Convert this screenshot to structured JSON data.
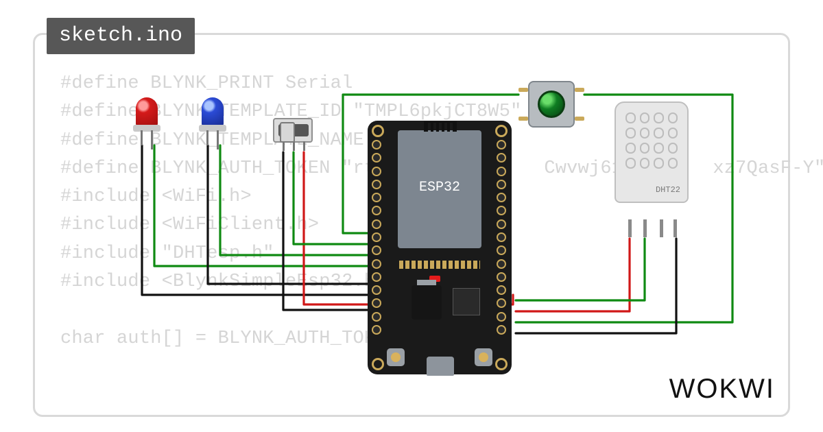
{
  "tab": {
    "filename": "sketch.ino"
  },
  "code": {
    "lines": [
      "#define BLYNK_PRINT Serial",
      "#define BLYNK_TEMPLATE_ID \"TMPL6pkjCT8W5\"",
      "#define BLYNK_TEMPLATE_NAME \"W\"",
      "#define BLYNK_AUTH_TOKEN \"rt8bt            Cwvwj61        xz7QasF-Y\"",
      "#include <WiFi.h>",
      "#include <WiFiClient.h>",
      "#include \"DHTesp.h\"",
      "#include <BlynkSimpleEsp32.h>",
      "",
      "char auth[] = BLYNK_AUTH_TOKEN; //                                                             a"
    ]
  },
  "logo": {
    "text": "WOKWI"
  },
  "components": {
    "mcu": {
      "label": "ESP32"
    },
    "sensor": {
      "label": "DHT22"
    },
    "led_red": {
      "color": "#d41a1a",
      "name": "led-red"
    },
    "led_blue": {
      "color": "#2b4bd6",
      "name": "led-blue"
    },
    "slide_switch": {
      "name": "slide-switch"
    },
    "push_button": {
      "color": "green",
      "name": "push-button"
    }
  },
  "wires": {
    "colors": {
      "gnd": "#111111",
      "vcc": "#d01818",
      "sig": "#0f8a12"
    }
  }
}
